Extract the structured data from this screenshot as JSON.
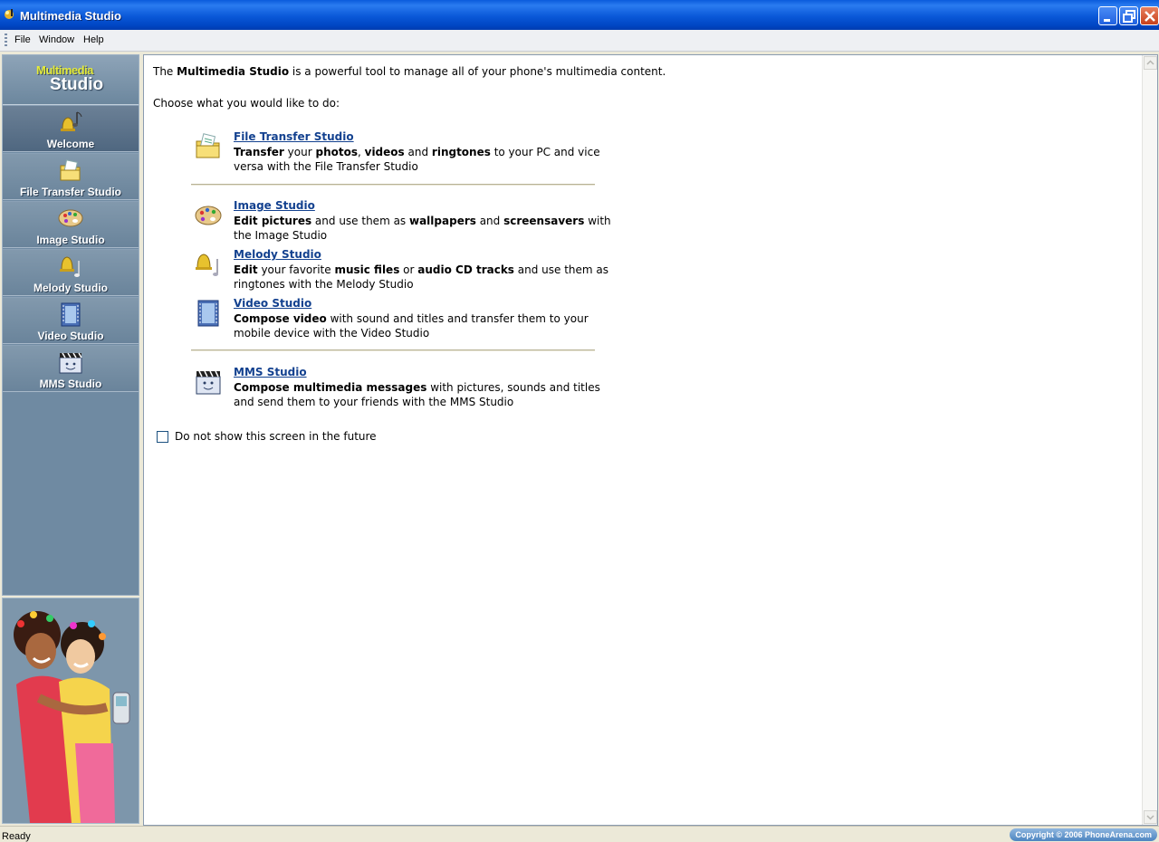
{
  "window": {
    "title": "Multimedia Studio"
  },
  "menu": [
    "File",
    "Window",
    "Help"
  ],
  "sidebar": {
    "logo_line1": "Multimedia",
    "logo_line2": "Studio",
    "items": [
      {
        "label": "Welcome",
        "icon": "welcome-icon",
        "active": true
      },
      {
        "label": "File Transfer Studio",
        "icon": "file-transfer-icon"
      },
      {
        "label": "Image Studio",
        "icon": "palette-icon"
      },
      {
        "label": "Melody Studio",
        "icon": "bell-note-icon"
      },
      {
        "label": "Video Studio",
        "icon": "film-icon"
      },
      {
        "label": "MMS Studio",
        "icon": "clapper-icon"
      }
    ]
  },
  "main": {
    "intro_prefix": "The ",
    "intro_bold": "Multimedia Studio",
    "intro_suffix": " is a powerful tool to manage all of your phone's multimedia content.",
    "choose": "Choose what you would like to do:",
    "entries": [
      {
        "title": "File Transfer Studio",
        "icon": "file-transfer-icon",
        "desc": [
          {
            "b": true,
            "t": "Transfer"
          },
          {
            "t": " your "
          },
          {
            "b": true,
            "t": "photos"
          },
          {
            "t": ", "
          },
          {
            "b": true,
            "t": "videos"
          },
          {
            "t": " and "
          },
          {
            "b": true,
            "t": "ringtones"
          },
          {
            "t": " to your PC and vice versa with the File Transfer Studio"
          }
        ]
      },
      {
        "title": "Image Studio",
        "icon": "palette-icon",
        "desc": [
          {
            "b": true,
            "t": "Edit pictures"
          },
          {
            "t": " and use them as "
          },
          {
            "b": true,
            "t": "wallpapers"
          },
          {
            "t": " and "
          },
          {
            "b": true,
            "t": "screensavers"
          },
          {
            "t": " with the Image Studio"
          }
        ]
      },
      {
        "title": "Melody Studio",
        "icon": "bell-note-icon",
        "desc": [
          {
            "b": true,
            "t": "Edit"
          },
          {
            "t": " your favorite "
          },
          {
            "b": true,
            "t": "music files"
          },
          {
            "t": " or "
          },
          {
            "b": true,
            "t": "audio CD tracks"
          },
          {
            "t": " and use them as ringtones with the Melody Studio"
          }
        ]
      },
      {
        "title": "Video Studio",
        "icon": "film-icon",
        "desc": [
          {
            "b": true,
            "t": "Compose video"
          },
          {
            "t": " with sound and titles and transfer them to your mobile device with the Video Studio"
          }
        ]
      },
      {
        "title": "MMS Studio",
        "icon": "clapper-icon",
        "desc": [
          {
            "b": true,
            "t": "Compose multimedia messages"
          },
          {
            "t": " with pictures, sounds and titles and send them to your friends with the MMS Studio"
          }
        ]
      }
    ],
    "checkbox_label": "Do not show this screen in the future",
    "checkbox_checked": false
  },
  "status": {
    "text": "Ready",
    "copyright": "Copyright © 2006 PhoneArena.com"
  },
  "colors": {
    "titlebar": "#0a58d8",
    "sidebar": "#6f8aa2",
    "link": "#13418f"
  }
}
